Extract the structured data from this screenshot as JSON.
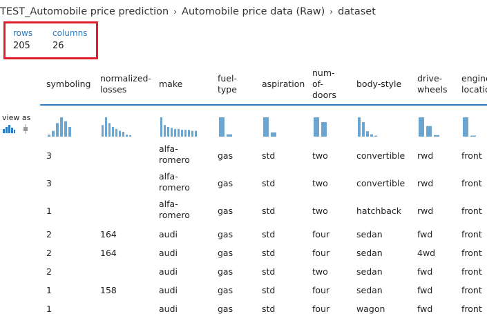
{
  "breadcrumb": {
    "items": [
      "TEST_Automobile price prediction",
      "Automobile price data (Raw)",
      "dataset"
    ],
    "separator": "›"
  },
  "stats": {
    "rows_label": "rows",
    "rows_value": "205",
    "columns_label": "columns",
    "columns_value": "26"
  },
  "view_as_label": "view as",
  "columns": [
    {
      "key": "symboling",
      "lines": [
        "symboling"
      ]
    },
    {
      "key": "normalized-losses",
      "lines": [
        "normalized-",
        "losses"
      ]
    },
    {
      "key": "make",
      "lines": [
        "make"
      ]
    },
    {
      "key": "fuel-type",
      "lines": [
        "fuel-",
        "type"
      ]
    },
    {
      "key": "aspiration",
      "lines": [
        "aspiration"
      ]
    },
    {
      "key": "num-of-doors",
      "lines": [
        "num-",
        "of-",
        "doors"
      ]
    },
    {
      "key": "body-style",
      "lines": [
        "body-style"
      ]
    },
    {
      "key": "drive-wheels",
      "lines": [
        "drive-",
        "wheels"
      ]
    },
    {
      "key": "engine-location",
      "lines": [
        "engine-",
        "location"
      ]
    }
  ],
  "rows": [
    [
      "3",
      "",
      "alfa-romero",
      "gas",
      "std",
      "two",
      "convertible",
      "rwd",
      "front"
    ],
    [
      "3",
      "",
      "alfa-romero",
      "gas",
      "std",
      "two",
      "convertible",
      "rwd",
      "front"
    ],
    [
      "1",
      "",
      "alfa-romero",
      "gas",
      "std",
      "two",
      "hatchback",
      "rwd",
      "front"
    ],
    [
      "2",
      "164",
      "audi",
      "gas",
      "std",
      "four",
      "sedan",
      "fwd",
      "front"
    ],
    [
      "2",
      "164",
      "audi",
      "gas",
      "std",
      "four",
      "sedan",
      "4wd",
      "front"
    ],
    [
      "2",
      "",
      "audi",
      "gas",
      "std",
      "two",
      "sedan",
      "fwd",
      "front"
    ],
    [
      "1",
      "158",
      "audi",
      "gas",
      "std",
      "four",
      "sedan",
      "fwd",
      "front"
    ],
    [
      "1",
      "",
      "audi",
      "gas",
      "std",
      "four",
      "wagon",
      "fwd",
      "front"
    ]
  ],
  "histograms": [
    [
      0.1,
      0.3,
      0.7,
      1.0,
      0.8,
      0.5
    ],
    [
      0.6,
      1.0,
      0.7,
      0.5,
      0.4,
      0.3,
      0.25,
      0.1,
      0.08
    ],
    [
      1.0,
      0.6,
      0.5,
      0.45,
      0.4,
      0.4,
      0.35,
      0.35,
      0.35,
      0.3,
      0.3
    ],
    [
      1.0,
      0.12
    ],
    [
      1.0,
      0.22
    ],
    [
      1.0,
      0.75
    ],
    [
      1.0,
      0.75,
      0.28,
      0.12,
      0.05
    ],
    [
      1.0,
      0.55,
      0.08
    ],
    [
      1.0,
      0.05
    ]
  ],
  "colors": {
    "accent": "#2b7bc2",
    "highlight_box": "#e01e2b",
    "histogram": "#6ba6d1"
  }
}
